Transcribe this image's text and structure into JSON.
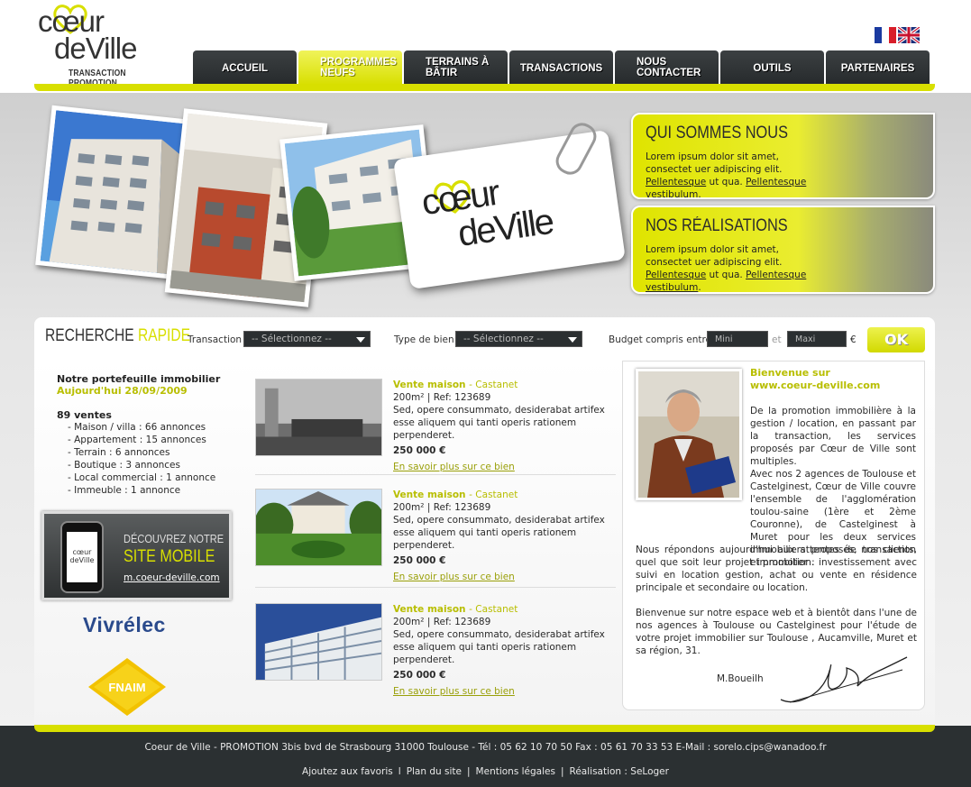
{
  "header": {
    "logo_line1": "cœur",
    "logo_line2": "deVille",
    "logo_tagline": "TRANSACTION PROMOTION",
    "flags": [
      "flag-fr",
      "flag-en"
    ]
  },
  "nav": {
    "items": [
      {
        "label": "ACCUEIL",
        "active": false
      },
      {
        "label": "PROGRAMMES NEUFS",
        "active": true
      },
      {
        "label": "TERRAINS À BÂTIR",
        "active": false
      },
      {
        "label": "TRANSACTIONS",
        "active": false
      },
      {
        "label": "NOUS CONTACTER",
        "active": false
      },
      {
        "label": "OUTILS",
        "active": false
      },
      {
        "label": "PARTENAIRES",
        "active": false
      }
    ]
  },
  "hero": {
    "card_line1": "cœur",
    "card_line2": "deVille"
  },
  "promos": [
    {
      "title": "QUI SOMMES NOUS",
      "text": "Lorem ipsum dolor sit amet, consectet uer adipiscing elit.",
      "link1": "Pellentesque",
      "text2": "ut qua.",
      "link2": "Pellentesque vestibulum",
      "end": "."
    },
    {
      "title": "NOS RÉALISATIONS",
      "text": "Lorem ipsum dolor sit amet, consectet uer adipiscing elit.",
      "link1": "Pellentesque",
      "text2": "ut qua.",
      "link2": "Pellentesque vestibulum",
      "end": "."
    }
  ],
  "search": {
    "title_a": "RECHERCHE",
    "title_b": "RAPIDE",
    "transaction_label": "Transaction",
    "transaction_value": "-- Sélectionnez --",
    "type_label": "Type de bien",
    "type_value": "-- Sélectionnez --",
    "budget_label": "Budget compris entre",
    "min_placeholder": "Mini",
    "and_label": "et",
    "max_placeholder": "Maxi",
    "currency": "€",
    "ok_label": "OK"
  },
  "portfolio": {
    "heading": "Notre portefeuille immobilier",
    "date": "Aujourd'hui 28/09/2009",
    "count": "89  ventes",
    "items": [
      "- Maison / villa : 66 annonces",
      "- Appartement : 15 annonces",
      "- Terrain : 6 annonces",
      "- Boutique : 3 annonces",
      "- Local commercial : 1 annonce",
      "- Immeuble : 1 annonce"
    ]
  },
  "mobile": {
    "line1": "DÉCOUVREZ NOTRE",
    "line2": "SITE MOBILE",
    "url": "m.coeur-deville.com",
    "screen_text": "cœur deVille"
  },
  "partners": {
    "vivrelec": "Vivrélec",
    "fnaim": "FNAIM"
  },
  "listings": [
    {
      "title": "Vente maison",
      "city": "- Castanet",
      "ref": "200m² | Ref: 123689",
      "desc": "Sed, opere consummato, desiderabat artifex esse aliquem qui tanti operis rationem perpenderet.",
      "price": "250 000 €",
      "link": "En savoir plus sur ce bien"
    },
    {
      "title": "Vente maison",
      "city": "- Castanet",
      "ref": "200m² | Ref: 123689",
      "desc": "Sed, opere consummato, desiderabat artifex esse aliquem qui tanti operis rationem perpenderet.",
      "price": "250 000 €",
      "link": "En savoir plus sur ce bien"
    },
    {
      "title": "Vente maison",
      "city": "- Castanet",
      "ref": "200m² | Ref: 123689",
      "desc": "Sed, opere consummato, desiderabat artifex esse aliquem qui tanti operis rationem perpenderet.",
      "price": "250 000 €",
      "link": "En savoir plus sur ce bien"
    }
  ],
  "welcome": {
    "title1": "Bienvenue sur",
    "title2": "www.coeur-deville.com",
    "p1": "De la promotion immobilière à la gestion / location, en passant par la transaction, les services proposés par Cœur de Ville sont multiples.",
    "p2": "Avec nos 2 agences de Toulouse et Castelginest, Cœur de Ville couvre l'ensemble de l'agglomération toulou-saine (1ère et 2ème Couronne), de Castelginest à Muret pour les deux services immobiliers proposés, transaction et promotion.",
    "p3": "Nous répondons aujourd'hui aux attentes de nos clients, quel que soit leur projet immobilier : investissement avec suivi en location gestion, achat ou vente en résidence principale et secondaire ou location.",
    "p4": "Bienvenue sur notre espace web et à bientôt dans l'une de nos agences à Toulouse ou Castelginest pour l'étude de votre projet immobilier sur Toulouse , Aucamville, Muret et sa région, 31.",
    "signature_name": "M.Boueilh"
  },
  "footer": {
    "address": "Coeur de Ville - PROMOTION 3bis bvd de Strasbourg 31000 Toulouse - Tél : 05 62 10 70 50 Fax : 05 61 70 33 53   E-Mail : sorelo.cips@wanadoo.fr",
    "links": [
      "Ajoutez aux favoris",
      "Plan du site",
      "Mentions légales",
      "Réalisation : SeLoger"
    ],
    "separators": [
      "l",
      "|",
      "|",
      "|"
    ]
  }
}
